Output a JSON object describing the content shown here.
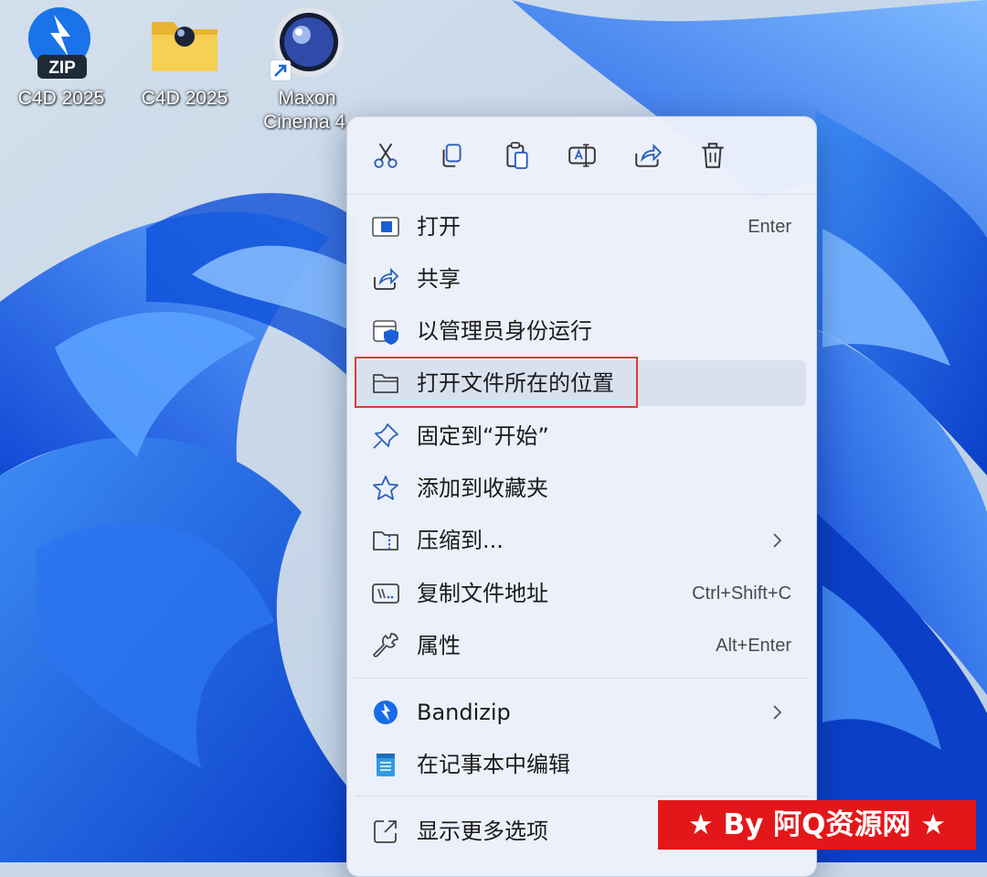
{
  "desktop": {
    "icons": [
      {
        "label": "C4D 2025",
        "icon": "bandizip-zip-icon"
      },
      {
        "label": "C4D 2025",
        "icon": "folder-icon"
      },
      {
        "label_line1": "Maxon",
        "label_line2": "Cinema 4.",
        "icon": "cinema4d-icon"
      }
    ]
  },
  "menu": {
    "toolbar": [
      {
        "name": "cut",
        "icon": "scissors-icon"
      },
      {
        "name": "copy",
        "icon": "copy-icon"
      },
      {
        "name": "paste",
        "icon": "paste-icon"
      },
      {
        "name": "rename",
        "icon": "rename-icon"
      },
      {
        "name": "share",
        "icon": "share-icon"
      },
      {
        "name": "delete",
        "icon": "trash-icon"
      }
    ],
    "items": [
      {
        "label": "打开",
        "shortcut": "Enter",
        "icon": "open-icon"
      },
      {
        "label": "共享",
        "shortcut": "",
        "icon": "share-icon"
      },
      {
        "label": "以管理员身份运行",
        "shortcut": "",
        "icon": "shield-icon"
      },
      {
        "label": "打开文件所在的位置",
        "shortcut": "",
        "icon": "folder-icon"
      },
      {
        "label": "固定到“开始”",
        "shortcut": "",
        "icon": "pin-icon"
      },
      {
        "label": "添加到收藏夹",
        "shortcut": "",
        "icon": "star-icon"
      },
      {
        "label": "压缩到...",
        "shortcut": "",
        "icon": "zip-folder-icon"
      },
      {
        "label": "复制文件地址",
        "shortcut": "Ctrl+Shift+C",
        "icon": "path-icon"
      },
      {
        "label": "属性",
        "shortcut": "Alt+Enter",
        "icon": "wrench-icon"
      },
      {
        "label": "Bandizip",
        "shortcut": "",
        "icon": "bandizip-icon"
      },
      {
        "label": "在记事本中编辑",
        "shortcut": "",
        "icon": "notepad-icon"
      },
      {
        "label": "显示更多选项",
        "shortcut": "",
        "icon": "more-options-icon"
      }
    ]
  },
  "watermark": {
    "text": "★ By 阿Q资源网 ★"
  },
  "colors": {
    "accent": "#1a73e8",
    "highlight_border": "#e53935",
    "watermark_bg": "#e3171a"
  }
}
